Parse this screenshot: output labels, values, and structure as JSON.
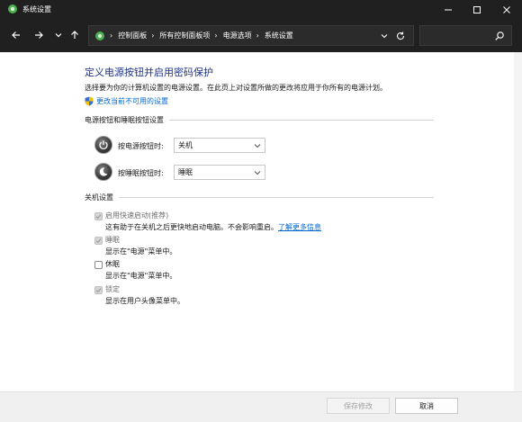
{
  "window": {
    "title": "系统设置"
  },
  "address": {
    "crumbs": [
      "控制面板",
      "所有控制面板项",
      "电源选项",
      "系统设置"
    ],
    "separator": "›"
  },
  "search": {
    "placeholder": ""
  },
  "page": {
    "title": "定义电源按钮并启用密码保护",
    "description": "选择要为你的计算机设置的电源设置。在此页上对设置所做的更改将应用于你所有的电源计划。",
    "change_link": "更改当前不可用的设置"
  },
  "power_section": {
    "heading": "电源按钮和睡眠按钮设置",
    "power_button": {
      "label": "按电源按钮时:",
      "value": "关机"
    },
    "sleep_button": {
      "label": "按睡眠按钮时:",
      "value": "睡眠"
    }
  },
  "shutdown_section": {
    "heading": "关机设置",
    "options": [
      {
        "label": "启用快速启动(推荐)",
        "checked": true,
        "desc": "这有助于在关机之后更快地启动电脑。不会影响重启。",
        "link": "了解更多信息"
      },
      {
        "label": "睡眠",
        "checked": true,
        "desc": "显示在\"电源\"菜单中。"
      },
      {
        "label": "休眠",
        "checked": false,
        "desc": "显示在\"电源\"菜单中。"
      },
      {
        "label": "锁定",
        "checked": true,
        "desc": "显示在用户头像菜单中。"
      }
    ]
  },
  "footer": {
    "save_label": "保存修改",
    "cancel_label": "取消"
  },
  "colors": {
    "titlebar": "#202020",
    "heading": "#1e3287",
    "link": "#0066cc"
  }
}
